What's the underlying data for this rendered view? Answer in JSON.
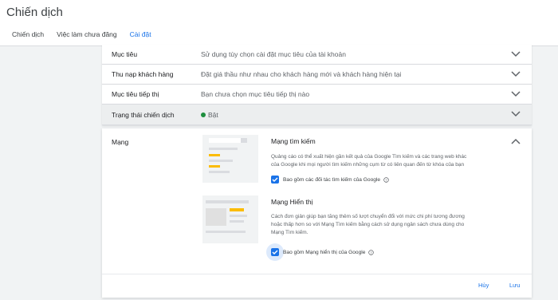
{
  "header": {
    "title": "Chiến dịch",
    "tabs": [
      {
        "label": "Chiến dịch",
        "active": false
      },
      {
        "label": "Việc làm chưa đăng",
        "active": false
      },
      {
        "label": "Cài đặt",
        "active": true
      }
    ]
  },
  "settings_rows": [
    {
      "label": "Mục tiêu",
      "value": "Sử dụng tùy chọn cài đặt mục tiêu của tài khoản"
    },
    {
      "label": "Thu nạp khách hàng",
      "value": "Đặt giá thầu như nhau cho khách hàng mới và khách hàng hiện tại"
    },
    {
      "label": "Mục tiêu tiếp thị",
      "value": "Bạn chưa chọn mục tiêu tiếp thị nào"
    },
    {
      "label": "Trạng thái chiến dịch",
      "value": "Bật",
      "status_color": "#1e8e3e"
    }
  ],
  "network_panel": {
    "label": "Mạng",
    "search": {
      "title": "Mạng tìm kiếm",
      "description_line1": "Quảng cáo có thể xuất hiện gần kết quả của Google Tìm kiếm và các trang web khác",
      "description_line2": "của Google khi mọi người tìm kiếm những cụm từ có liên quan đến từ khóa của bạn",
      "checkbox_label": "Bao gồm các đối tác tìm kiếm của Google",
      "checked": true
    },
    "display": {
      "title": "Mạng Hiển thị",
      "description_line1": "Cách đơn giản giúp bạn tăng thêm số lượt chuyển đổi với mức chi phí tương đương",
      "description_line2": "hoặc thấp hơn so với Mạng Tìm kiếm bằng cách sử dụng ngân sách chưa dùng cho",
      "description_line3": "Mạng Tìm kiếm.",
      "checkbox_label": "Bao gồm Mạng hiển thị của Google",
      "checked": true
    },
    "cancel_label": "Hủy",
    "save_label": "Lưu"
  },
  "colors": {
    "accent": "#1a73e8",
    "status_on": "#1e8e3e"
  }
}
